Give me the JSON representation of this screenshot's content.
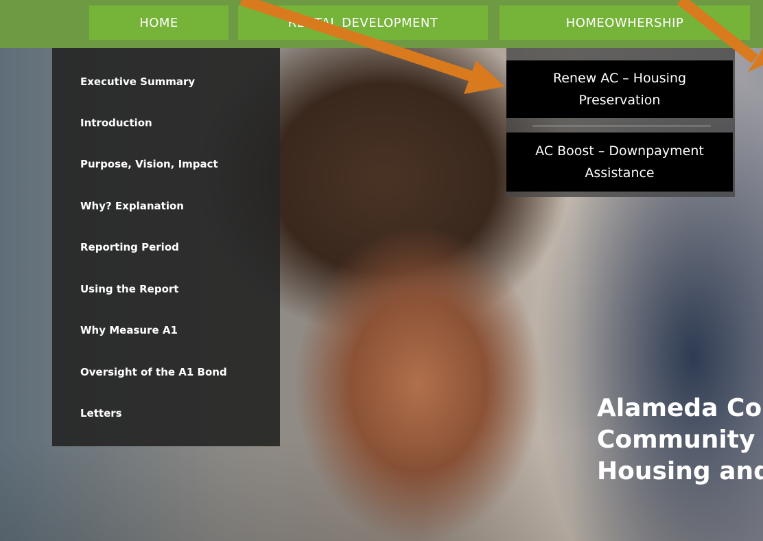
{
  "nav": {
    "home": "HOME",
    "rental": "RENTAL DEVELOPMENT",
    "homeownership": "HOMEOWHERSHIP"
  },
  "left_menu": {
    "items": [
      "Executive Summary",
      "Introduction",
      "Purpose, Vision, Impact",
      "Why? Explanation",
      "Reporting Period",
      "Using the Report",
      "Why Measure A1",
      "Oversight of the A1 Bond",
      "Letters"
    ]
  },
  "right_menu": {
    "items": [
      "Renew AC – Housing Preservation",
      "AC Boost – Downpayment Assistance"
    ]
  },
  "hero": {
    "headline_lines": [
      "Alameda Cou",
      "Community",
      "Housing and"
    ]
  },
  "colors": {
    "nav_bar": "#6f9a44",
    "nav_button": "#76b339",
    "annotation_arrow": "#d97a1f"
  }
}
